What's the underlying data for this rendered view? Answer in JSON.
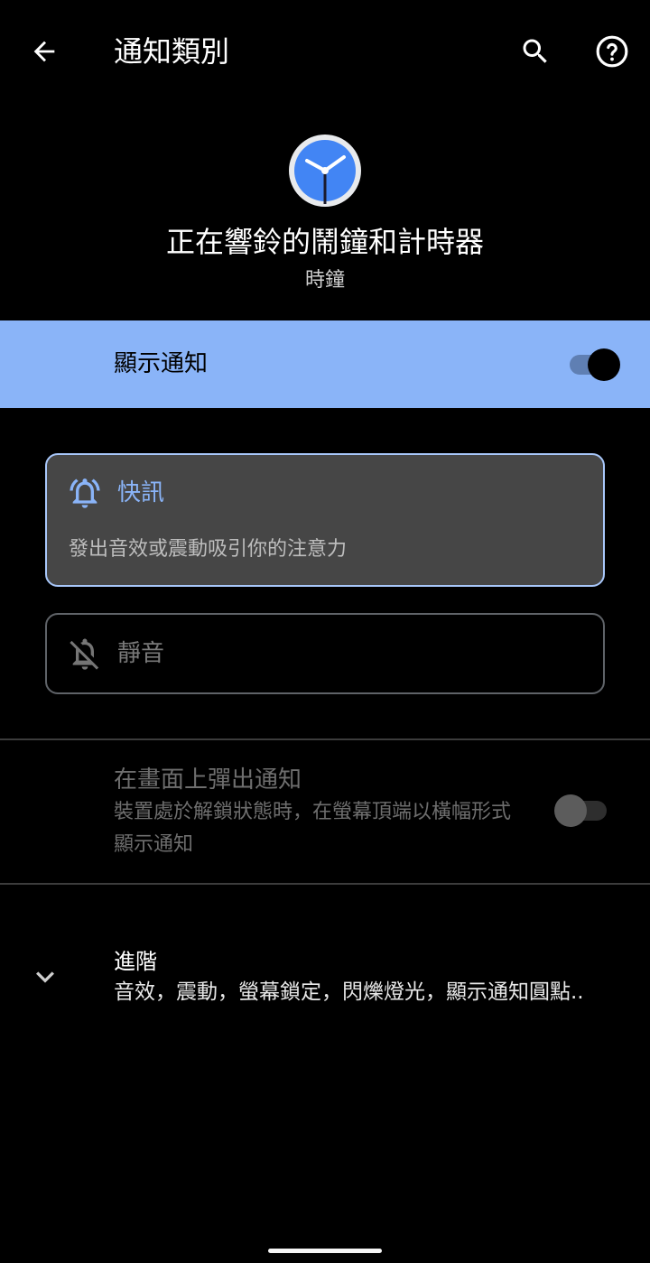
{
  "app_bar": {
    "title": "通知類別",
    "back_icon": "arrow-back-icon",
    "search_icon": "search-icon",
    "help_icon": "help-circle-icon"
  },
  "header": {
    "app_icon": "clock-icon",
    "channel_title": "正在響鈴的鬧鐘和計時器",
    "app_name": "時鐘"
  },
  "show_notifications": {
    "label": "顯示通知",
    "enabled": true,
    "background_color": "#8ab4f8"
  },
  "importance": {
    "alerting": {
      "icon": "bell-icon",
      "title": "快訊",
      "description": "發出音效或震動吸引你的注意力",
      "selected": true
    },
    "silent": {
      "icon": "bell-off-icon",
      "title": "靜音",
      "selected": false
    }
  },
  "pop_on_screen": {
    "title": "在畫面上彈出通知",
    "summary": "裝置處於解鎖狀態時，在螢幕頂端以橫幅形式顯示通知",
    "enabled": false,
    "disabled_state": true
  },
  "advanced": {
    "icon": "chevron-down-icon",
    "title": "進階",
    "summary": "音效，震動，螢幕鎖定，閃爍燈光，顯示通知圓點.."
  },
  "colors": {
    "background": "#000000",
    "accent": "#8ab4f8",
    "selected_card_border": "#a8c7fa",
    "selected_card_bg": "#464646",
    "disabled_text": "#6e6e6e"
  }
}
